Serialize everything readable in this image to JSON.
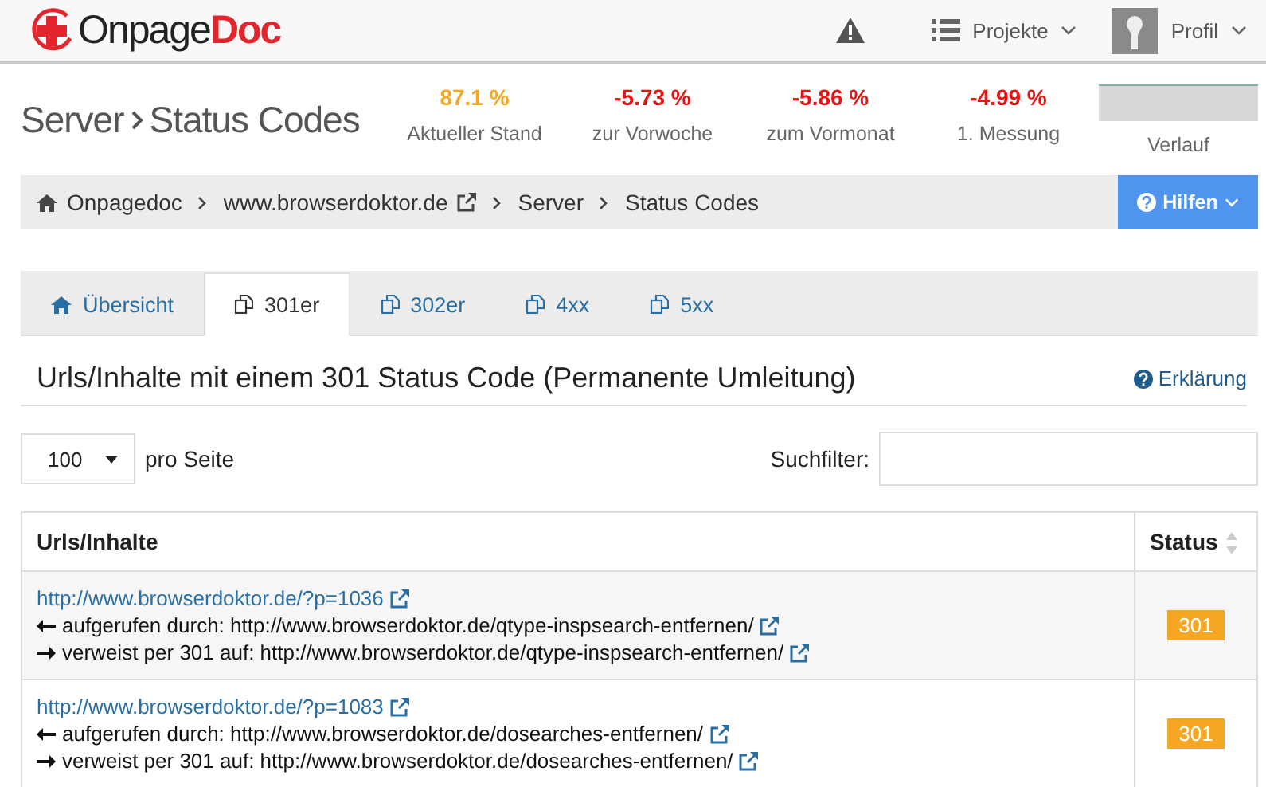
{
  "header": {
    "logo": {
      "name": "Onpage",
      "accent": "Doc"
    },
    "menus": [
      {
        "label": "Projekte",
        "kind": "list"
      },
      {
        "label": "Profil",
        "kind": "profile"
      }
    ]
  },
  "page_title": {
    "section": "Server",
    "page": "Status Codes"
  },
  "stats": [
    {
      "value": "87.1 %",
      "label": "Aktueller Stand",
      "color": "#f5a623"
    },
    {
      "value": "-5.73 %",
      "label": "zur Vorwoche",
      "color": "#ee1111"
    },
    {
      "value": "-5.86 %",
      "label": "zum Vormonat",
      "color": "#ee1111"
    },
    {
      "value": "-4.99 %",
      "label": "1. Messung",
      "color": "#ee1111"
    }
  ],
  "trend": {
    "label": "Verlauf"
  },
  "breadcrumb": [
    {
      "label": "Onpagedoc",
      "kind": "home"
    },
    {
      "label": "www.browserdoktor.de",
      "kind": "external"
    },
    {
      "label": "Server",
      "kind": "plain"
    },
    {
      "label": "Status Codes",
      "kind": "plain"
    }
  ],
  "help_button": {
    "label": "Hilfen"
  },
  "tabs": [
    {
      "label": "Übersicht",
      "kind": "home",
      "selected": false
    },
    {
      "label": "301er",
      "kind": "copy",
      "selected": true
    },
    {
      "label": "302er",
      "kind": "copy",
      "selected": false
    },
    {
      "label": "4xx",
      "kind": "copy",
      "selected": false
    },
    {
      "label": "5xx",
      "kind": "copy",
      "selected": false
    }
  ],
  "section": {
    "heading": "Urls/Inhalte mit einem 301 Status Code (Permanente Umleitung)",
    "explain_link": "Erklärung"
  },
  "paging": {
    "value": "100",
    "label": "pro Seite"
  },
  "search": {
    "label": "Suchfilter:"
  },
  "table": {
    "columns": [
      "Urls/Inhalte",
      "Status"
    ],
    "rows": [
      {
        "url": "http://www.browserdoktor.de/?p=1036",
        "called_by": "aufgerufen durch: http://www.browserdoktor.de/qtype-inspsearch-entfernen/",
        "redirects_to": "verweist per 301 auf: http://www.browserdoktor.de/qtype-inspsearch-entfernen/",
        "status": "301"
      },
      {
        "url": "http://www.browserdoktor.de/?p=1083",
        "called_by": "aufgerufen durch: http://www.browserdoktor.de/dosearches-entfernen/",
        "redirects_to": "verweist per 301 auf: http://www.browserdoktor.de/dosearches-entfernen/",
        "status": "301"
      }
    ]
  }
}
